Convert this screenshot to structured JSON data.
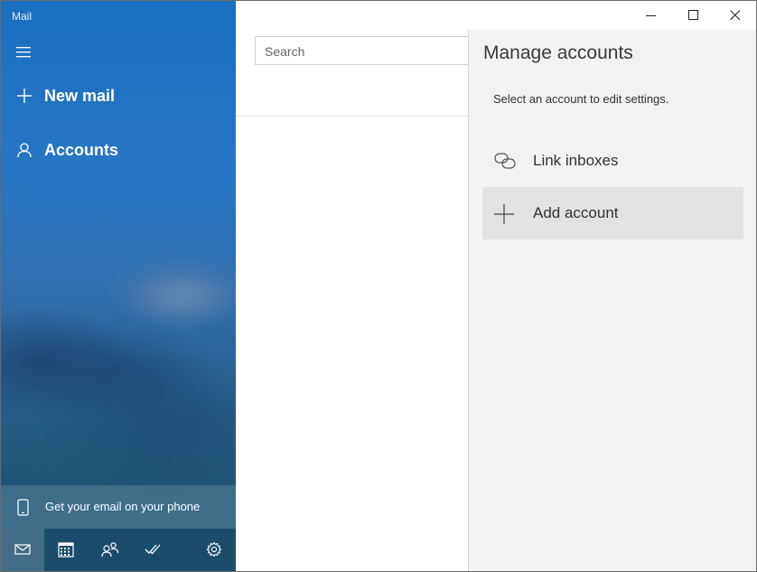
{
  "app": {
    "title": "Mail"
  },
  "nav": {
    "menu_icon": "hamburger-icon",
    "new_mail_label": "New mail",
    "accounts_label": "Accounts",
    "phone_promo_label": "Get your email on your phone",
    "bottom_icons": [
      "mail-icon",
      "calendar-icon",
      "people-icon",
      "todo-icon",
      "settings-icon"
    ]
  },
  "list": {
    "search_placeholder": "Search"
  },
  "manage_accounts": {
    "title": "Manage accounts",
    "subtitle": "Select an account to edit settings.",
    "link_inboxes_label": "Link inboxes",
    "add_account_label": "Add account"
  },
  "colors": {
    "accent": "#1a6fc0",
    "pane_bg": "#f2f2f2",
    "hover_bg": "#e2e2e2"
  }
}
